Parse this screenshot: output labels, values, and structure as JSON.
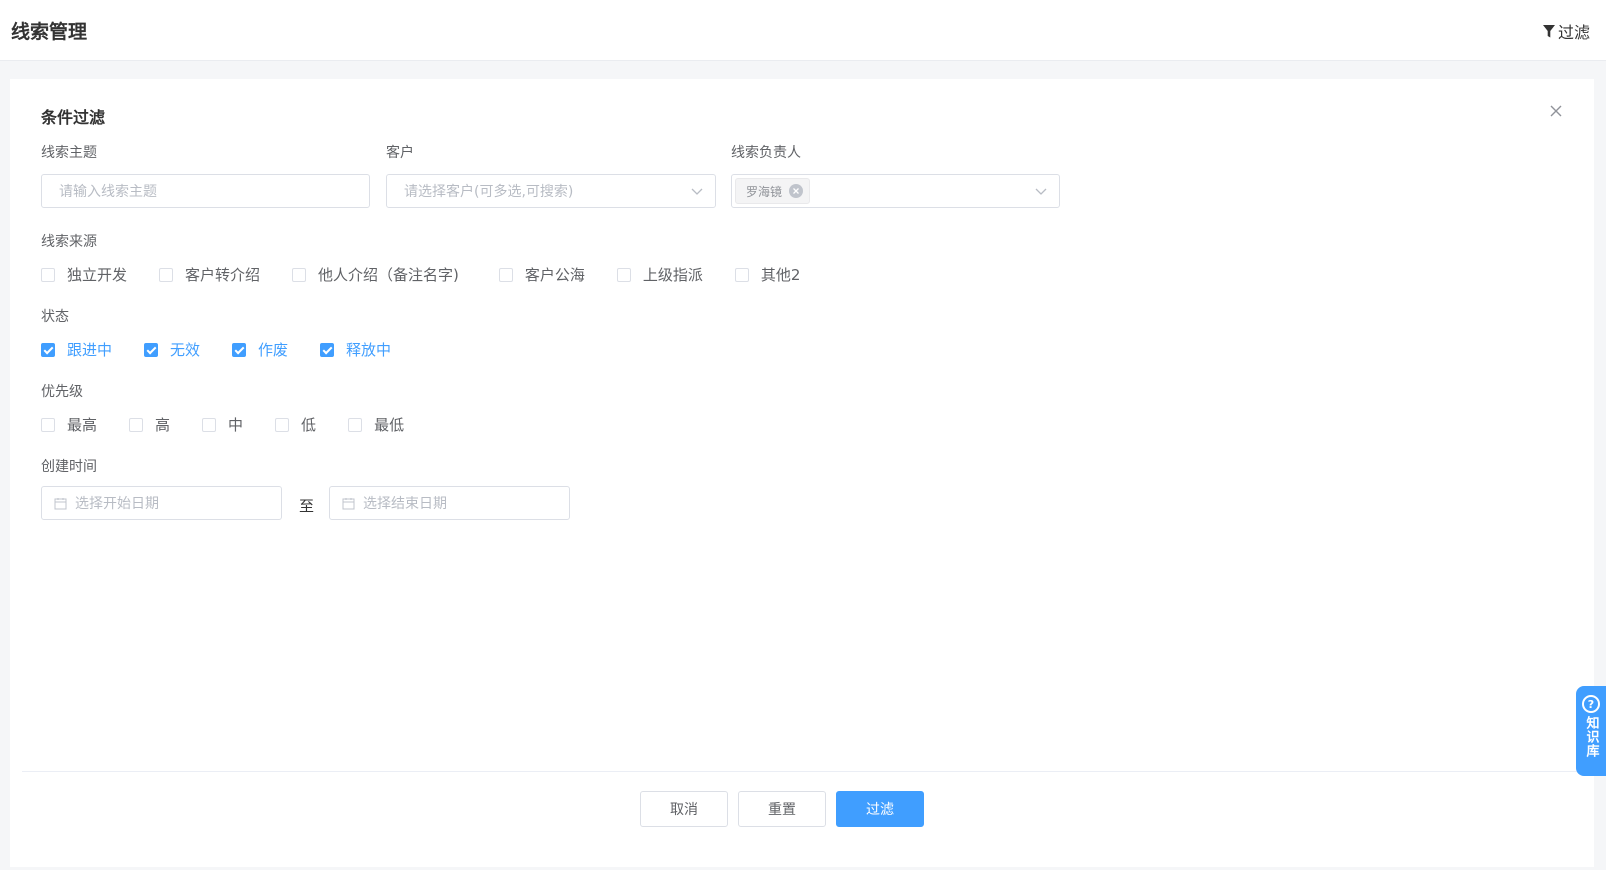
{
  "header": {
    "title": "线索管理",
    "filter_label": "过滤"
  },
  "panel": {
    "title": "条件过滤"
  },
  "fields": {
    "subject": {
      "label": "线索主题",
      "placeholder": "请输入线索主题"
    },
    "customer": {
      "label": "客户",
      "placeholder": "请选择客户(可多选,可搜索)"
    },
    "owner": {
      "label": "线索负责人",
      "tag": "罗海镜"
    }
  },
  "source": {
    "label": "线索来源",
    "options": [
      {
        "label": "独立开发",
        "checked": false
      },
      {
        "label": "客户转介绍",
        "checked": false
      },
      {
        "label": "他人介绍（备注名字)",
        "checked": false
      },
      {
        "label": "客户公海",
        "checked": false
      },
      {
        "label": "上级指派",
        "checked": false
      },
      {
        "label": "其他2",
        "checked": false
      }
    ]
  },
  "status": {
    "label": "状态",
    "options": [
      {
        "label": "跟进中",
        "checked": true
      },
      {
        "label": "无效",
        "checked": true
      },
      {
        "label": "作废",
        "checked": true
      },
      {
        "label": "释放中",
        "checked": true
      }
    ]
  },
  "priority": {
    "label": "优先级",
    "options": [
      {
        "label": "最高",
        "checked": false
      },
      {
        "label": "高",
        "checked": false
      },
      {
        "label": "中",
        "checked": false
      },
      {
        "label": "低",
        "checked": false
      },
      {
        "label": "最低",
        "checked": false
      }
    ]
  },
  "created": {
    "label": "创建时间",
    "start_placeholder": "选择开始日期",
    "to_label": "至",
    "end_placeholder": "选择结束日期"
  },
  "buttons": {
    "cancel": "取消",
    "reset": "重置",
    "filter": "过滤"
  },
  "knowledge_base": {
    "label": "知识库"
  },
  "colors": {
    "accent": "#409eff",
    "border": "#dcdfe6"
  }
}
